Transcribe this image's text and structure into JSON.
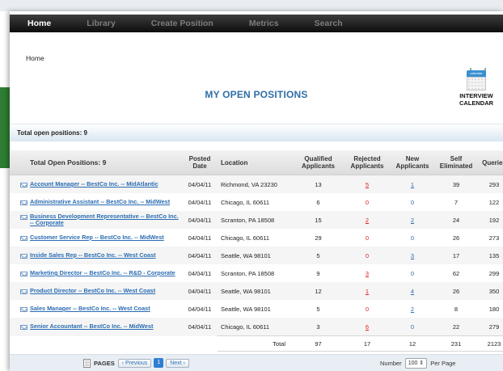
{
  "nav": {
    "home": "Home",
    "library": "Library",
    "create_position": "Create Position",
    "metrics": "Metrics",
    "search": "Search"
  },
  "breadcrumb": "Home",
  "page_title": "MY OPEN POSITIONS",
  "calendar": {
    "icon": "calendar-icon",
    "icon_text": "calendar",
    "line1": "INTERVIEW",
    "line2": "CALENDAR"
  },
  "summary": "Total open positions: 9",
  "table": {
    "headers": {
      "positions": "Total Open Positions:  9",
      "posted_1": "Posted",
      "posted_2": "Date",
      "location": "Location",
      "qualified_1": "Qualified",
      "qualified_2": "Applicants",
      "rejected_1": "Rejected",
      "rejected_2": "Applicants",
      "new_1": "New",
      "new_2": "Applicants",
      "self_1": "Self",
      "self_2": "Eliminated",
      "queries": "Queries"
    },
    "rows": [
      {
        "title": "Account Manager -- BestCo Inc. -- MidAtlantic",
        "date": "04/04/11",
        "location": "Richmond, VA 23230",
        "qualified": "13",
        "rejected": "5",
        "new": "1",
        "self": "39",
        "queries": "293"
      },
      {
        "title": "Administrative Assistant -- BestCo Inc. -- MidWest",
        "date": "04/04/11",
        "location": "Chicago, IL 60611",
        "qualified": "6",
        "rejected": "0",
        "new": "0",
        "self": "7",
        "queries": "122"
      },
      {
        "title": "Business Development Representative -- BestCo Inc. -- Corporate",
        "date": "04/04/11",
        "location": "Scranton, PA 18508",
        "qualified": "15",
        "rejected": "2",
        "new": "2",
        "self": "24",
        "queries": "192"
      },
      {
        "title": "Customer Service Rep -- BestCo Inc. -- MidWest",
        "date": "04/04/11",
        "location": "Chicago, IL 60611",
        "qualified": "29",
        "rejected": "0",
        "new": "0",
        "self": "26",
        "queries": "273"
      },
      {
        "title": "Inside Sales Rep -- BestCo Inc. -- West Coast",
        "date": "04/04/11",
        "location": "Seattle, WA 98101",
        "qualified": "5",
        "rejected": "0",
        "new": "3",
        "self": "17",
        "queries": "135"
      },
      {
        "title": "Marketing Director -- BestCo Inc. -- R&D - Corporate",
        "date": "04/04/11",
        "location": "Scranton, PA 18508",
        "qualified": "9",
        "rejected": "3",
        "new": "0",
        "self": "62",
        "queries": "299"
      },
      {
        "title": "Product Director -- BestCo Inc. -- West Coast",
        "date": "04/04/11",
        "location": "Seattle, WA 98101",
        "qualified": "12",
        "rejected": "1",
        "new": "4",
        "self": "26",
        "queries": "350"
      },
      {
        "title": "Sales Manager -- BestCo Inc. -- West Coast",
        "date": "04/04/11",
        "location": "Seattle, WA 98101",
        "qualified": "5",
        "rejected": "0",
        "new": "2",
        "self": "8",
        "queries": "180"
      },
      {
        "title": "Senior Accountant -- BestCo Inc. -- MidWest",
        "date": "04/04/11",
        "location": "Chicago, IL 60611",
        "qualified": "3",
        "rejected": "6",
        "new": "0",
        "self": "22",
        "queries": "279"
      }
    ],
    "totals": {
      "label": "Total",
      "qualified": "97",
      "rejected": "17",
      "new": "12",
      "self": "231",
      "queries": "2123"
    }
  },
  "pagination": {
    "label": "PAGES",
    "prev": "‹ Previous",
    "current": "1",
    "next": "Next ›",
    "number_label": "Number",
    "per_page_value": "100",
    "per_page_label": "Per Page"
  },
  "colors": {
    "accent": "#2f6fa6",
    "link": "#2b6db3",
    "rejected": "#e02020",
    "nav_bg": "#1a1a1a"
  }
}
